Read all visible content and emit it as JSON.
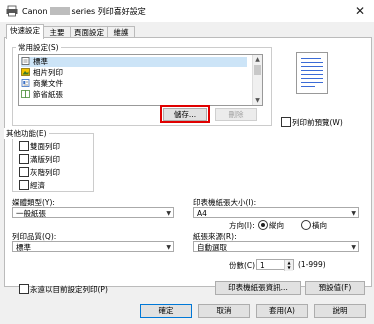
{
  "window": {
    "title_prefix": "Canon",
    "title_suffix": "series 列印喜好設定",
    "close": "✕"
  },
  "tabs": [
    {
      "label": "快速設定"
    },
    {
      "label": "主要"
    },
    {
      "label": "頁面設定"
    },
    {
      "label": "維護"
    }
  ],
  "common_settings": {
    "legend": "常用設定(S)",
    "items": [
      {
        "label": "標準",
        "icon_color": "#555555"
      },
      {
        "label": "相片列印",
        "icon_color": "#d9a400"
      },
      {
        "label": "商業文件",
        "icon_color": "#3a6fc4"
      },
      {
        "label": "節省紙張",
        "icon_color": "#4a8f3a"
      }
    ],
    "save_button": "儲存...",
    "delete_button": "刪除"
  },
  "preview_checkbox": "列印前預覽(W)",
  "other_features": {
    "legend": "其他功能(E)",
    "items": [
      "雙面列印",
      "滿版列印",
      "灰階列印",
      "經濟"
    ]
  },
  "media_type": {
    "label": "媒體類型(Y):",
    "value": "一般紙張"
  },
  "printer_paper_size": {
    "label": "印表機紙張大小(I):",
    "value": "A4"
  },
  "orientation": {
    "label": "方向(I):",
    "portrait": "縱向",
    "landscape": "橫向",
    "selected": "portrait"
  },
  "print_quality": {
    "label": "列印品質(Q):",
    "value": "標準"
  },
  "paper_source": {
    "label": "紙張來源(R):",
    "value": "自動選取"
  },
  "copies": {
    "label": "份數(C):",
    "value": "1",
    "range": "(1-999)"
  },
  "always_print_current": "永遠以目前設定列印(P)",
  "printer_paper_info_button": "印表機紙張資訊...",
  "defaults_button": "預設值(F)",
  "footer": {
    "ok": "確定",
    "cancel": "取消",
    "apply": "套用(A)",
    "help": "說明"
  }
}
